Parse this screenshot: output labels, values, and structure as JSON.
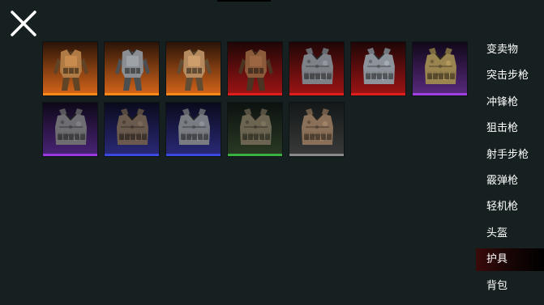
{
  "header": {
    "close_icon": "close-icon"
  },
  "inventory": {
    "items": [
      {
        "name": "vest-1",
        "rarity": "orange",
        "bg_top": "#2a1408",
        "bg_bottom": "#d8661a",
        "bar": "#ff8a1a",
        "kind": "suit",
        "tint": "#b07a45"
      },
      {
        "name": "vest-2",
        "rarity": "orange",
        "bg_top": "#2a1408",
        "bg_bottom": "#d8661a",
        "bar": "#ff8a1a",
        "kind": "suit",
        "tint": "#8a8e92"
      },
      {
        "name": "vest-3",
        "rarity": "orange",
        "bg_top": "#2a1408",
        "bg_bottom": "#d8661a",
        "bar": "#ff8a1a",
        "kind": "suit",
        "tint": "#b48a5e"
      },
      {
        "name": "vest-4",
        "rarity": "red",
        "bg_top": "#1e0606",
        "bg_bottom": "#a01414",
        "bar": "#e01e1e",
        "kind": "suit",
        "tint": "#8a5a3a"
      },
      {
        "name": "vest-5",
        "rarity": "red",
        "bg_top": "#1e0606",
        "bg_bottom": "#a01414",
        "bar": "#e01e1e",
        "kind": "vest",
        "tint": "#7e8288"
      },
      {
        "name": "vest-6",
        "rarity": "red",
        "bg_top": "#1e0606",
        "bg_bottom": "#a01414",
        "bar": "#e01e1e",
        "kind": "vest",
        "tint": "#8c939a"
      },
      {
        "name": "vest-7",
        "rarity": "purple",
        "bg_top": "#100818",
        "bg_bottom": "#5a2a80",
        "bar": "#a040e0",
        "kind": "vest",
        "tint": "#9a8450"
      },
      {
        "name": "vest-8",
        "rarity": "purple",
        "bg_top": "#0e0818",
        "bg_bottom": "#4a2478",
        "bar": "#9a38e0",
        "kind": "vest",
        "tint": "#6e6e72"
      },
      {
        "name": "vest-9",
        "rarity": "blue",
        "bg_top": "#0a0a1c",
        "bg_bottom": "#2a2a7a",
        "bar": "#3a4ae0",
        "kind": "vest",
        "tint": "#6a5a4e"
      },
      {
        "name": "vest-10",
        "rarity": "blue",
        "bg_top": "#0a0a1c",
        "bg_bottom": "#2a2a7a",
        "bar": "#3a4ae0",
        "kind": "vest",
        "tint": "#7a7c84"
      },
      {
        "name": "vest-11",
        "rarity": "green",
        "bg_top": "#0c1210",
        "bg_bottom": "#2a3a24",
        "bar": "#3ab040",
        "kind": "vest",
        "tint": "#6a6450"
      },
      {
        "name": "vest-12",
        "rarity": "grey",
        "bg_top": "#141818",
        "bg_bottom": "#3a3a3a",
        "bar": "#8a8a8a",
        "kind": "vest",
        "tint": "#8a7058"
      }
    ]
  },
  "menu": {
    "items": [
      {
        "label": "变卖物",
        "active": false
      },
      {
        "label": "突击步枪",
        "active": false
      },
      {
        "label": "冲锋枪",
        "active": false
      },
      {
        "label": "狙击枪",
        "active": false
      },
      {
        "label": "射手步枪",
        "active": false
      },
      {
        "label": "霰弹枪",
        "active": false
      },
      {
        "label": "轻机枪",
        "active": false
      },
      {
        "label": "头盔",
        "active": false
      },
      {
        "label": "护具",
        "active": true
      },
      {
        "label": "背包",
        "active": false
      }
    ]
  }
}
